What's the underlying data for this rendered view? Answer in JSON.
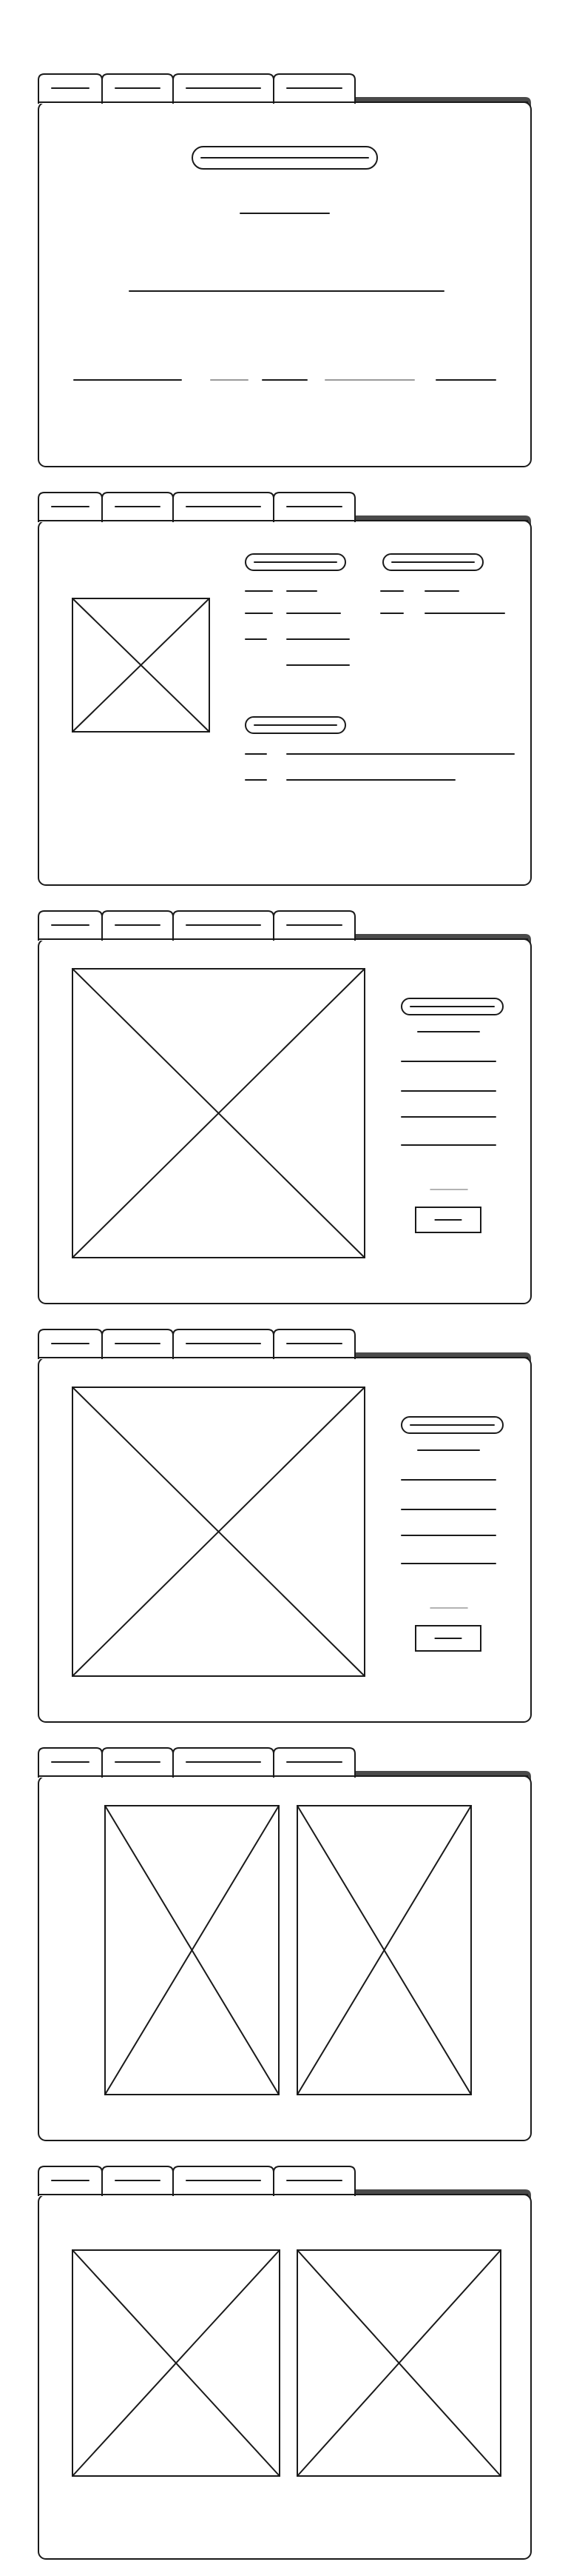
{
  "colors": {
    "background": "#ffffff",
    "stroke": "#1a1a1a",
    "light_stroke": "#9a9a9a",
    "tab_bar_dark": "#4a4a4a"
  },
  "icons": {
    "image_placeholder": "image-placeholder-icon",
    "window_tab": "tab-label-line"
  },
  "panels": [
    {
      "kind": "text-layout",
      "tabs": 4,
      "elements": [
        "pill-heading",
        "short-line",
        "long-line",
        "footer-links"
      ]
    },
    {
      "kind": "image-with-form",
      "tabs": 4,
      "images": 1,
      "elements": [
        "image",
        "two-pill-headings",
        "field-pairs",
        "third-pill-heading",
        "long-fields"
      ]
    },
    {
      "kind": "image-with-sidebar",
      "tabs": 4,
      "images": 1,
      "elements": [
        "image",
        "pill-heading",
        "lines",
        "divider",
        "button"
      ]
    },
    {
      "kind": "image-with-sidebar",
      "tabs": 4,
      "images": 1,
      "elements": [
        "image",
        "pill-heading",
        "lines",
        "divider",
        "button"
      ]
    },
    {
      "kind": "two-portrait-images",
      "tabs": 4,
      "images": 2
    },
    {
      "kind": "two-landscape-images",
      "tabs": 4,
      "images": 2
    }
  ]
}
